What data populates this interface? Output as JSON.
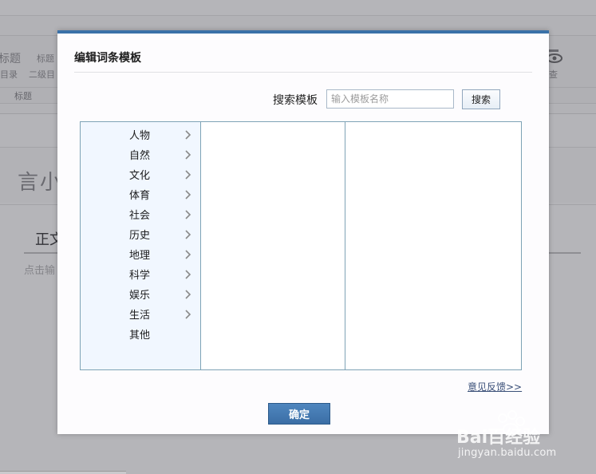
{
  "background": {
    "ribbon_items": [
      "标题",
      "标题",
      "目录",
      "二级目",
      "标题"
    ],
    "ribbon_right_label": "查",
    "article_title": "言小",
    "section_heading": "正文",
    "body_placeholder": "点击输"
  },
  "dialog": {
    "title": "编辑词条模板",
    "search_label": "搜索模板",
    "search_placeholder": "输入模板名称",
    "search_value": "",
    "search_button": "搜索",
    "categories": [
      {
        "label": "人物",
        "has_children": true
      },
      {
        "label": "自然",
        "has_children": true
      },
      {
        "label": "文化",
        "has_children": true
      },
      {
        "label": "体育",
        "has_children": true
      },
      {
        "label": "社会",
        "has_children": true
      },
      {
        "label": "历史",
        "has_children": true
      },
      {
        "label": "地理",
        "has_children": true
      },
      {
        "label": "科学",
        "has_children": true
      },
      {
        "label": "娱乐",
        "has_children": true
      },
      {
        "label": "生活",
        "has_children": true
      },
      {
        "label": "其他",
        "has_children": false
      }
    ],
    "feedback_link": "意见反馈>>",
    "confirm_button": "确定"
  },
  "watermark": {
    "logo": "Bai百经验",
    "url": "jingyan.baidu.com"
  },
  "colors": {
    "dialog_header_bar": "#3a71a8",
    "confirm_button": "#3b6ea5",
    "category_column_bg": "#f1f7ff",
    "picker_border": "#7ea3b6"
  }
}
